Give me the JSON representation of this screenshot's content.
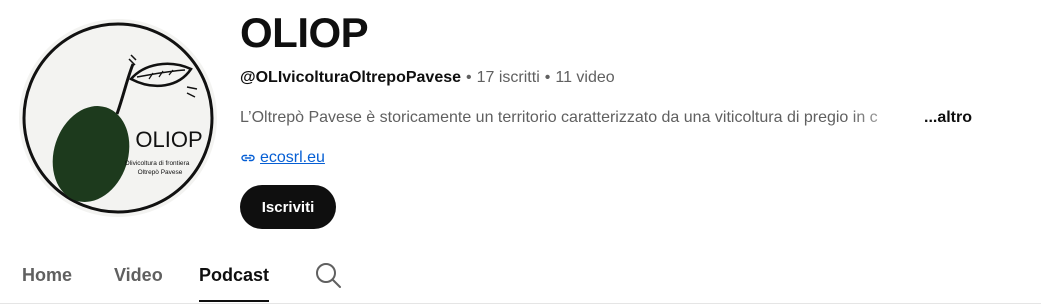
{
  "channel": {
    "name": "OLIOP",
    "handle": "@OLIvicolturaOltrepoPavese",
    "subscribers": "17 iscritti",
    "videos": "11 video",
    "separator": "•",
    "description": "L’Oltrepò Pavese è storicamente un territorio caratterizzato da una viticoltura di pregio in c",
    "more_label": "...altro",
    "link_text": "ecosrl.eu",
    "subscribe_label": "Iscriviti"
  },
  "avatar": {
    "logo_text": "OLIOP",
    "logo_subtitle_1": "Olivicoltura di frontiera",
    "logo_subtitle_2": "Oltrepò Pavese",
    "olive_color": "#1d3a1d",
    "background_color": "#f3f3f1"
  },
  "tabs": [
    {
      "label": "Home",
      "active": false
    },
    {
      "label": "Video",
      "active": false
    },
    {
      "label": "Podcast",
      "active": true
    }
  ],
  "icons": {
    "search": "search-icon",
    "link": "link-icon"
  },
  "colors": {
    "text_primary": "#0f0f0f",
    "text_secondary": "#606060",
    "link": "#065fd4",
    "subscribe_bg": "#0f0f0f"
  }
}
